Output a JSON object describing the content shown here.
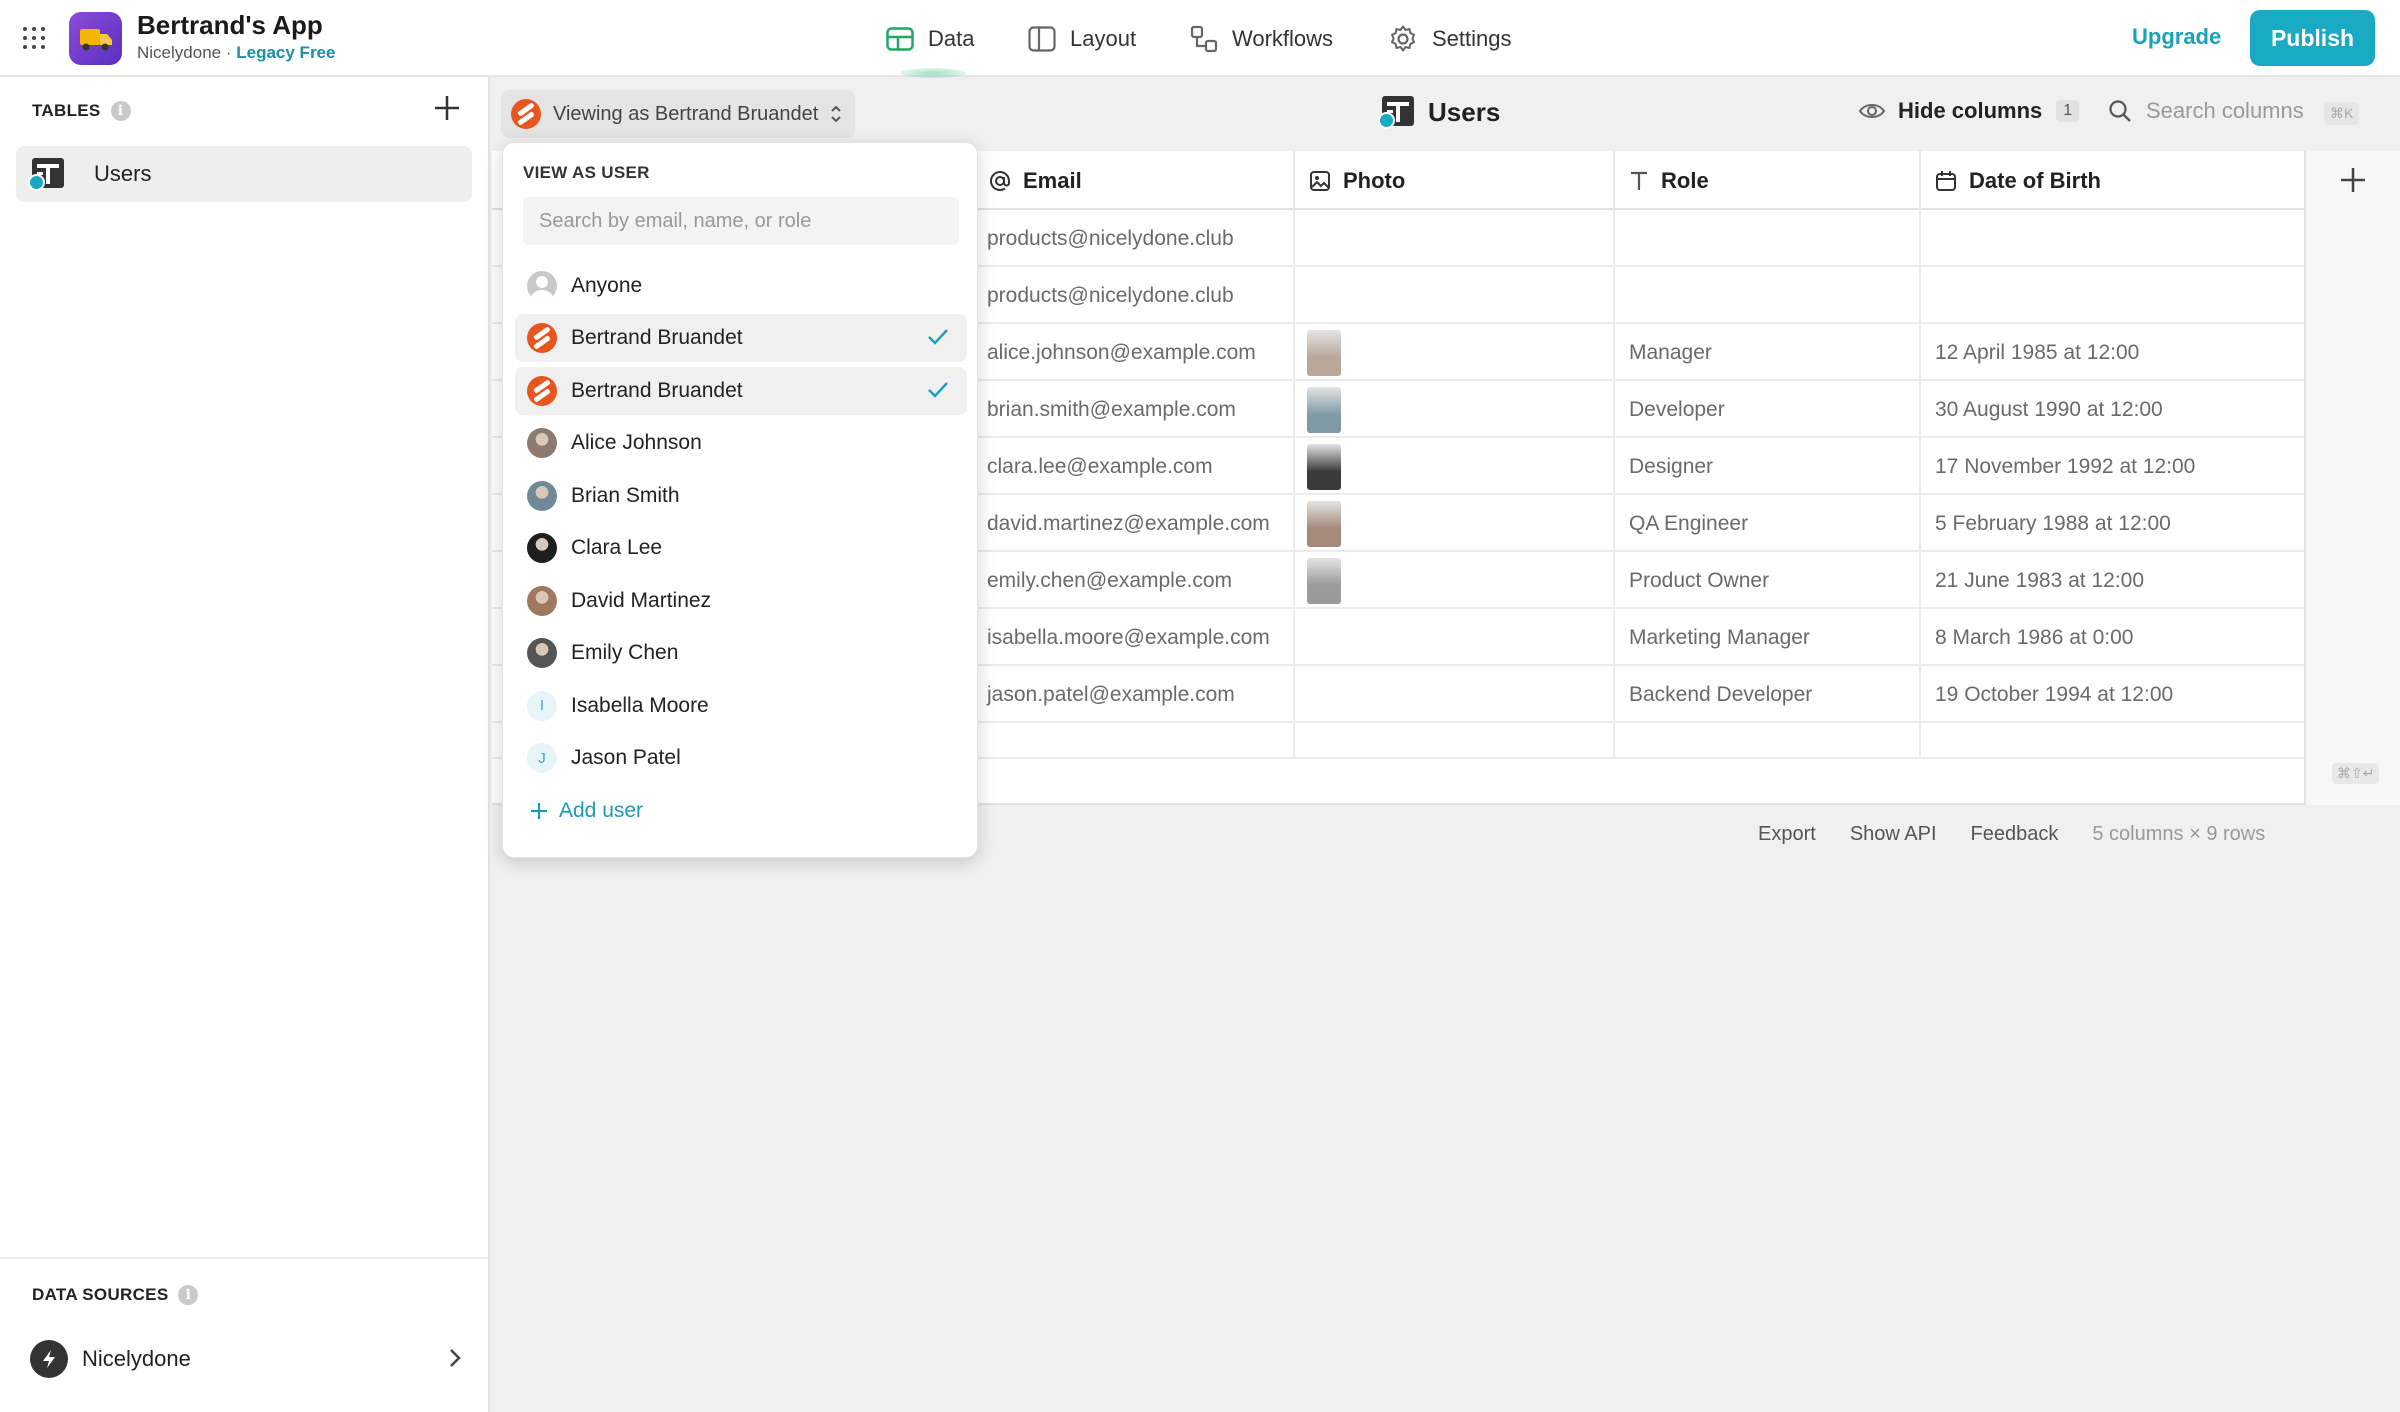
{
  "app": {
    "title": "Bertrand's App",
    "workspace": "Nicelydone",
    "separator": "·",
    "plan": "Legacy Free"
  },
  "nav": {
    "data": "Data",
    "layout": "Layout",
    "workflows": "Workflows",
    "settings": "Settings"
  },
  "top_actions": {
    "upgrade": "Upgrade",
    "publish": "Publish"
  },
  "sidebar": {
    "tables_label": "TABLES",
    "tables": [
      {
        "label": "Users"
      }
    ],
    "data_sources_label": "DATA SOURCES",
    "data_sources": [
      {
        "label": "Nicelydone"
      }
    ]
  },
  "toolbar": {
    "viewing_as": "Viewing as Bertrand Bruandet",
    "title": "Users",
    "hide_columns": "Hide columns",
    "hidden_count": "1",
    "search_placeholder": "Search columns",
    "search_shortcut": "⌘K"
  },
  "columns": [
    {
      "label": "Email",
      "icon": "at-icon"
    },
    {
      "label": "Photo",
      "icon": "image-icon"
    },
    {
      "label": "Role",
      "icon": "text-icon"
    },
    {
      "label": "Date of Birth",
      "icon": "calendar-icon"
    }
  ],
  "rows": [
    {
      "email": "products@nicelydone.club",
      "photo": "",
      "role": "",
      "dob": ""
    },
    {
      "email": "products@nicelydone.club",
      "photo": "",
      "role": "",
      "dob": ""
    },
    {
      "email": "alice.johnson@example.com",
      "photo": "#b8a89c",
      "role": "Manager",
      "dob": "12 April 1985 at 12:00"
    },
    {
      "email": "brian.smith@example.com",
      "photo": "#7f9aa6",
      "role": "Developer",
      "dob": "30 August 1990 at 12:00"
    },
    {
      "email": "clara.lee@example.com",
      "photo": "#3a3a3a",
      "role": "Designer",
      "dob": "17 November 1992 at 12:00"
    },
    {
      "email": "david.martinez@example.com",
      "photo": "#a58a7a",
      "role": "QA Engineer",
      "dob": "5 February 1988 at 12:00"
    },
    {
      "email": "emily.chen@example.com",
      "photo": "#9a9a9a",
      "role": "Product Owner",
      "dob": "21 June 1983 at 12:00"
    },
    {
      "email": " isabella.moore@example.com",
      "photo": "",
      "role": " Marketing Manager",
      "dob": "8 March 1986 at 0:00"
    },
    {
      "email": " jason.patel@example.com",
      "photo": "",
      "role": "Backend Developer",
      "dob": "19 October 1994 at 12:00"
    },
    {
      "email": "",
      "photo": "",
      "role": "",
      "dob": ""
    }
  ],
  "footer": {
    "export": "Export",
    "show_api": "Show API",
    "feedback": "Feedback",
    "meta": "5 columns × 9 rows",
    "enter_shortcut": "⌘⇧↵"
  },
  "dropdown": {
    "title": "VIEW AS USER",
    "search_placeholder": "Search by email, name, or role",
    "users": [
      {
        "name": "Anyone",
        "avatar": "anyone",
        "selected": false
      },
      {
        "name": "Bertrand Bruandet",
        "avatar": "brand",
        "selected": true
      },
      {
        "name": "Bertrand Bruandet",
        "avatar": "brand",
        "selected": true
      },
      {
        "name": "Alice Johnson",
        "avatar": "photo",
        "color": "#8a7a70",
        "selected": false
      },
      {
        "name": "Brian Smith",
        "avatar": "photo",
        "color": "#6f8a96",
        "selected": false
      },
      {
        "name": "Clara Lee",
        "avatar": "photo",
        "color": "#1e1e1e",
        "selected": false
      },
      {
        "name": "David Martinez",
        "avatar": "photo",
        "color": "#a07860",
        "selected": false
      },
      {
        "name": "Emily Chen",
        "avatar": "photo",
        "color": "#555555",
        "selected": false
      },
      {
        "name": "Isabella Moore",
        "avatar": "letter",
        "letter": "I",
        "selected": false
      },
      {
        "name": "Jason Patel",
        "avatar": "letter",
        "letter": "J",
        "selected": false
      }
    ],
    "add_user": "Add user"
  },
  "colors": {
    "accent": "#1aa9c2",
    "brand_orange": "#e8561f",
    "check": "#1aa1b9"
  }
}
